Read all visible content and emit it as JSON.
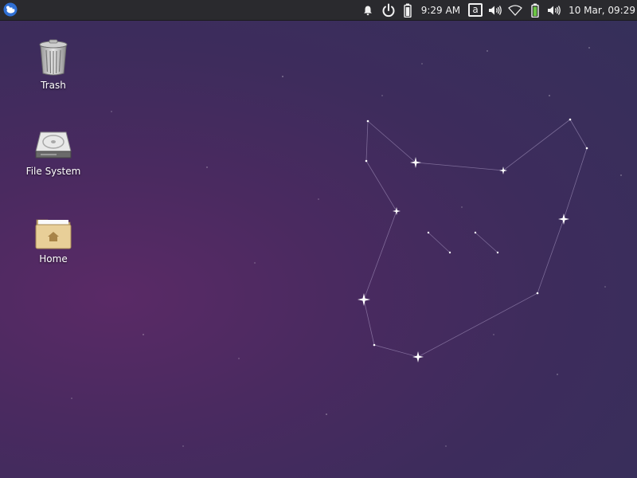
{
  "panel": {
    "menu_icon": "xfce-mouse-logo-icon",
    "tray": {
      "notifications_icon": "bell-icon",
      "power_icon": "power-icon",
      "battery_icon": "battery-icon",
      "time": "9:29 AM",
      "keyboard_layout": "a",
      "volume_icon": "speaker-icon",
      "network_icon": "wifi-icon",
      "battery2_icon": "battery-charging-icon",
      "volume2_icon": "speaker-icon",
      "datetime": "10 Mar, 09:29"
    }
  },
  "desktop": {
    "icons": [
      {
        "label": "Trash",
        "icon": "trash-icon"
      },
      {
        "label": "File System",
        "icon": "hard-drive-icon"
      },
      {
        "label": "Home",
        "icon": "home-folder-icon"
      }
    ]
  },
  "colors": {
    "panel_bg": "#2a2a2e",
    "wallpaper_base": "#3d2c5c",
    "accent_blue": "#3b7bd6",
    "battery_green": "#6cc644"
  }
}
